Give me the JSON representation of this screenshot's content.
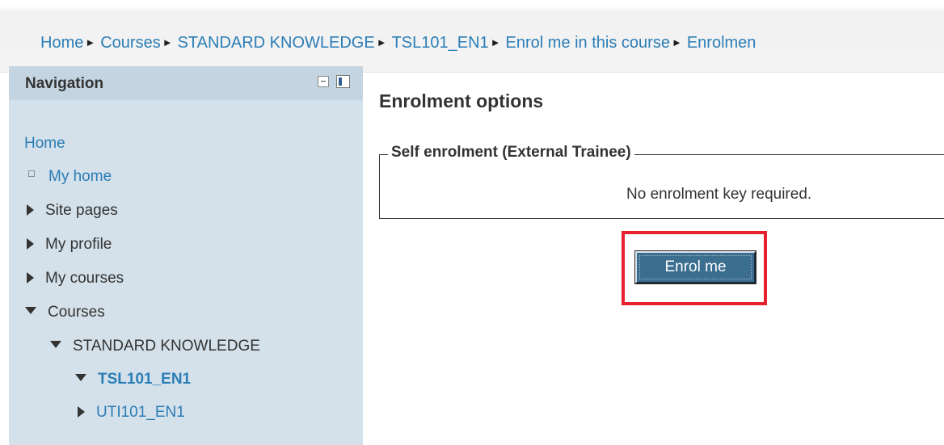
{
  "breadcrumb": {
    "items": [
      "Home",
      "Courses",
      "STANDARD KNOWLEDGE",
      "TSL101_EN1",
      "Enrol me in this course",
      "Enrolmen"
    ],
    "separator": "►"
  },
  "navigation": {
    "title": "Navigation",
    "home": "Home",
    "my_home": "My home",
    "site_pages": "Site pages",
    "my_profile": "My profile",
    "my_courses": "My courses",
    "courses": "Courses",
    "category": "STANDARD KNOWLEDGE",
    "course_current": "TSL101_EN1",
    "course_other": "UTI101_EN1"
  },
  "main": {
    "title": "Enrolment options",
    "fieldset_legend": "Self enrolment (External Trainee)",
    "note": "No enrolment key required.",
    "enrol_button_label": "Enrol me"
  },
  "colors": {
    "link": "#2b7db6",
    "nav_background": "#d4e1ea",
    "nav_header": "#c4d5e1",
    "button": "#3b6e8f",
    "highlight": "#e8212e"
  }
}
